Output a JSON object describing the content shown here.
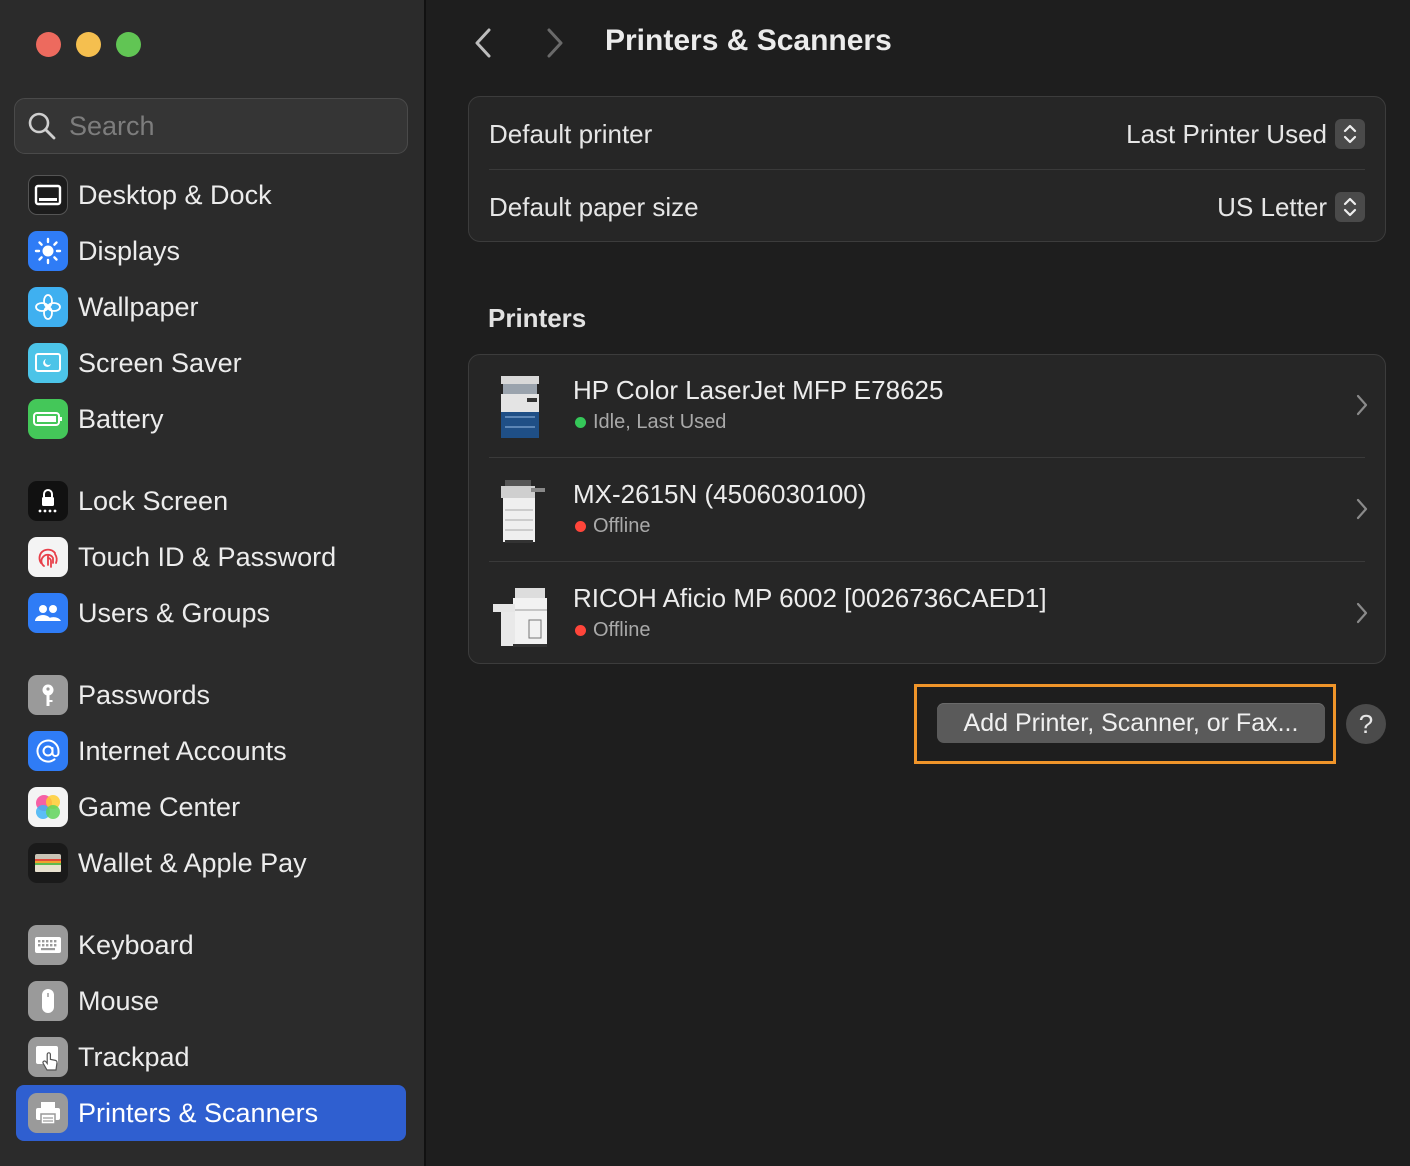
{
  "window": {
    "title": "Printers & Scanners"
  },
  "search": {
    "placeholder": "Search"
  },
  "sidebar": {
    "items": [
      {
        "label": "Desktop & Dock",
        "icon": "desktop-dock-icon"
      },
      {
        "label": "Displays",
        "icon": "displays-icon"
      },
      {
        "label": "Wallpaper",
        "icon": "wallpaper-icon"
      },
      {
        "label": "Screen Saver",
        "icon": "screen-saver-icon"
      },
      {
        "label": "Battery",
        "icon": "battery-icon"
      },
      {
        "label": "Lock Screen",
        "icon": "lock-screen-icon"
      },
      {
        "label": "Touch ID & Password",
        "icon": "fingerprint-icon"
      },
      {
        "label": "Users & Groups",
        "icon": "users-icon"
      },
      {
        "label": "Passwords",
        "icon": "key-icon"
      },
      {
        "label": "Internet Accounts",
        "icon": "at-icon"
      },
      {
        "label": "Game Center",
        "icon": "game-center-icon"
      },
      {
        "label": "Wallet & Apple Pay",
        "icon": "wallet-icon"
      },
      {
        "label": "Keyboard",
        "icon": "keyboard-icon"
      },
      {
        "label": "Mouse",
        "icon": "mouse-icon"
      },
      {
        "label": "Trackpad",
        "icon": "trackpad-icon"
      },
      {
        "label": "Printers & Scanners",
        "icon": "printer-icon",
        "selected": true
      }
    ]
  },
  "defaults": {
    "printer_label": "Default printer",
    "printer_value": "Last Printer Used",
    "paper_label": "Default paper size",
    "paper_value": "US Letter"
  },
  "printers_section": {
    "title": "Printers",
    "items": [
      {
        "name": "HP Color LaserJet MFP E78625",
        "status": "Idle, Last Used",
        "status_color": "#35c759"
      },
      {
        "name": "MX-2615N (4506030100)",
        "status": "Offline",
        "status_color": "#ff453a"
      },
      {
        "name": "RICOH Aficio MP 6002 [0026736CAED1]",
        "status": "Offline",
        "status_color": "#ff453a"
      }
    ]
  },
  "actions": {
    "add_label": "Add Printer, Scanner, or Fax...",
    "help_label": "?"
  },
  "colors": {
    "accent": "#2f5fd0",
    "highlight": "#f0952a"
  }
}
